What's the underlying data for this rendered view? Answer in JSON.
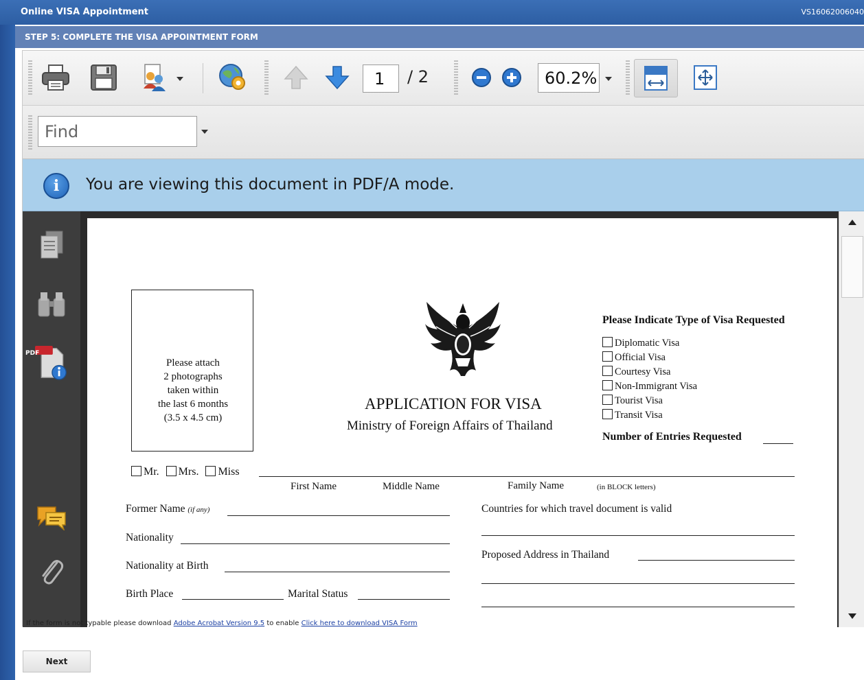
{
  "app": {
    "title": "Online VISA Appointment",
    "reference": "VS16062006040"
  },
  "step": {
    "title": "STEP 5: COMPLETE THE VISA APPOINTMENT FORM"
  },
  "toolbar": {
    "current_page": "1",
    "page_total": "/ 2",
    "zoom": "60.2%"
  },
  "find": {
    "placeholder": "Find"
  },
  "infobar": {
    "message": "You are viewing this document in PDF/A mode."
  },
  "sidebar": {
    "icons": [
      "pages-icon",
      "binoculars-icon",
      "pdf-info-icon",
      "comments-icon",
      "attachment-icon"
    ],
    "pdf_badge": "PDF"
  },
  "document": {
    "photo_box": {
      "line1": "Please attach",
      "line2": "2 photographs",
      "line3": "taken within",
      "line4": "the last 6 months",
      "line5": "(3.5 x 4.5 cm)"
    },
    "title": "APPLICATION FOR VISA",
    "subtitle": "Ministry of Foreign Affairs of Thailand",
    "visa_type_heading": "Please Indicate Type of Visa Requested",
    "visa_types": [
      "Diplomatic Visa",
      "Official Visa",
      "Courtesy Visa",
      "Non-Immigrant Visa",
      "Tourist Visa",
      "Transit Visa"
    ],
    "entries_label": "Number of Entries Requested",
    "salutations": [
      "Mr.",
      "Mrs.",
      "Miss"
    ],
    "name_captions": {
      "first": "First Name",
      "middle": "Middle Name",
      "family": "Family Name",
      "block_note": "(in BLOCK letters)"
    },
    "fields": {
      "former_name": "Former Name",
      "former_name_note": "(if any)",
      "nationality": "Nationality",
      "nationality_birth": "Nationality at Birth",
      "birth_place": "Birth Place",
      "marital_status": "Marital Status",
      "countries_valid": "Countries for which travel document is valid",
      "proposed_address": "Proposed Address in Thailand"
    }
  },
  "footer": {
    "note_prefix": "If the form is not typable please download",
    "acrobat_link": "Adobe Acrobat Version 9.5",
    "note_middle": "to enable",
    "download_link": "Click here to download VISA Form",
    "next_button": "Next"
  },
  "colors": {
    "frame_blue": "#2a5ea8",
    "step_bar": "#6181b6",
    "info_bar": "#a9cfeb",
    "side_panel": "#3d3d3d"
  }
}
